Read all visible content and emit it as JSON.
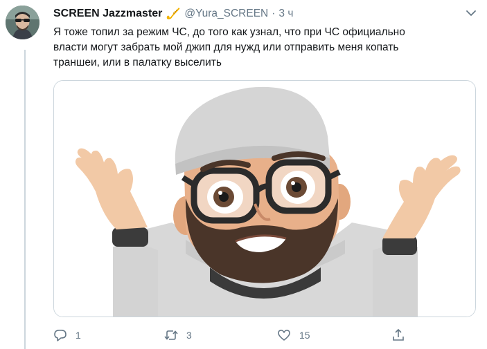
{
  "tweet": {
    "author": {
      "display_name": "SCREEN Jazzmaster",
      "handle": "@Yura_SCREEN",
      "badge_icon": "saxophone-icon"
    },
    "separator": "·",
    "timestamp": "3 ч",
    "text_lines": [
      "Я тоже топил за режим ЧС, до того как узнал, что при ЧС официально",
      "власти могут забрать мой джип для нужд или отправить меня копать",
      "траншеи, или в палатку выселить"
    ],
    "media": {
      "description_icon": "memoji-shrug-image"
    },
    "actions": {
      "reply": {
        "icon": "reply-icon",
        "count": "1"
      },
      "retweet": {
        "icon": "retweet-icon",
        "count": "3"
      },
      "like": {
        "icon": "heart-icon",
        "count": "15"
      },
      "share": {
        "icon": "share-icon"
      }
    }
  },
  "colors": {
    "text": "#14171a",
    "secondary": "#657786",
    "border": "#ccd6dd",
    "badge": "#f4b400"
  }
}
